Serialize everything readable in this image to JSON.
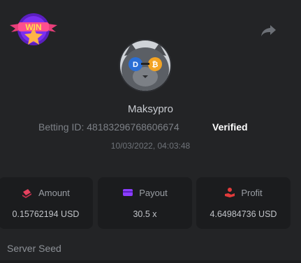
{
  "badge": {
    "text": "WIN",
    "icon": "win-star-badge"
  },
  "header": {
    "share_icon": "share-arrow-icon"
  },
  "user": {
    "avatar_icon": "cat-avatar",
    "name": "Maksypro",
    "betting_id_label": "Betting ID:",
    "betting_id": "48183296768606674",
    "verified": "Verified",
    "timestamp": "10/03/2022, 04:03:48"
  },
  "stats": {
    "amount": {
      "label": "Amount",
      "value": "0.15762194 USD",
      "icon": "coins-icon",
      "color": "#e8425f"
    },
    "payout": {
      "label": "Payout",
      "value": "30.5 x",
      "icon": "wallet-card-icon",
      "color": "#8b3dff"
    },
    "profit": {
      "label": "Profit",
      "value": "4.64984736 USD",
      "icon": "profit-hand-icon",
      "color": "#e23b3b"
    }
  },
  "section": {
    "server_seed_title": "Server Seed"
  },
  "colors": {
    "background": "#232426",
    "card": "#1b1c1e",
    "verified": "#ffffff"
  }
}
